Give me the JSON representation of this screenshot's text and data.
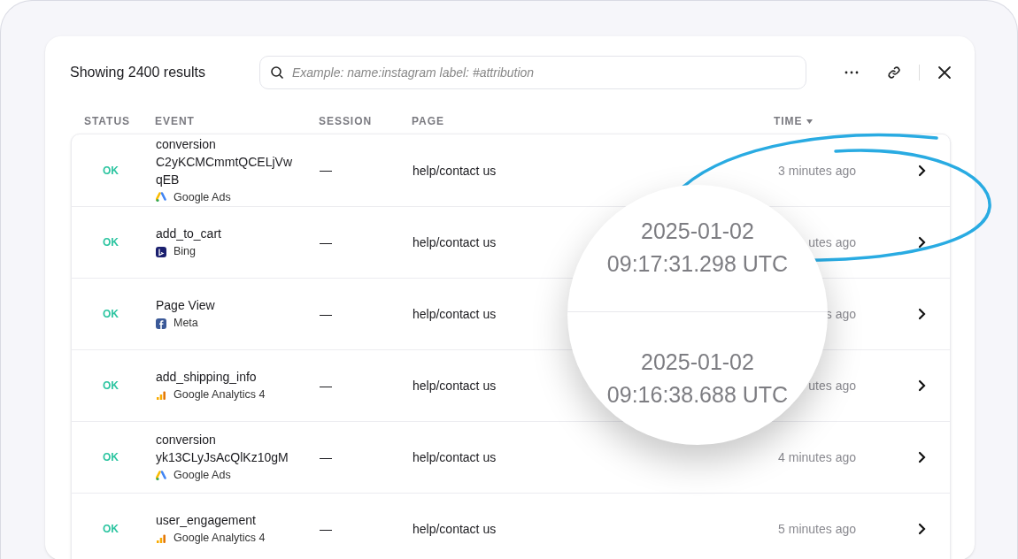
{
  "header": {
    "title": "Showing 2400 results",
    "search": {
      "placeholder": "Example: name:instagram label: #attribution"
    }
  },
  "columns": [
    {
      "label": "STATUS",
      "sorted": false
    },
    {
      "label": "EVENT",
      "sorted": false
    },
    {
      "label": "SESSION",
      "sorted": false
    },
    {
      "label": "PAGE",
      "sorted": false
    },
    {
      "label": "TIME",
      "sorted": true
    }
  ],
  "rows": [
    {
      "status": "OK",
      "event": [
        "conversion",
        "C2yKCMCmmtQCELjVw",
        "qEB"
      ],
      "source": {
        "kind": "google-ads",
        "name": "Google Ads"
      },
      "session": "—",
      "page": "help/contact us",
      "time": "3 minutes ago"
    },
    {
      "status": "OK",
      "event": [
        "add_to_cart"
      ],
      "source": {
        "kind": "bing",
        "name": "Bing"
      },
      "session": "—",
      "page": "help/contact us",
      "time": "utes ago"
    },
    {
      "status": "OK",
      "event": [
        "Page View"
      ],
      "source": {
        "kind": "meta",
        "name": "Meta"
      },
      "session": "—",
      "page": "help/contact us",
      "time": "s ago"
    },
    {
      "status": "OK",
      "event": [
        "add_shipping_info"
      ],
      "source": {
        "kind": "ga4",
        "name": "Google Analytics 4"
      },
      "session": "—",
      "page": "help/contact us",
      "time": "utes ago"
    },
    {
      "status": "OK",
      "event": [
        "conversion",
        "yk13CLyJsAcQlKz10gM"
      ],
      "source": {
        "kind": "google-ads",
        "name": "Google Ads"
      },
      "session": "—",
      "page": "help/contact us",
      "time": "4 minutes ago"
    },
    {
      "status": "OK",
      "event": [
        "user_engagement"
      ],
      "source": {
        "kind": "ga4",
        "name": "Google Analytics 4"
      },
      "session": "—",
      "page": "help/contact us",
      "time": "5 minutes ago"
    }
  ],
  "magnifier": [
    {
      "date": "2025-01-02",
      "time": "09:17:31.298 UTC"
    },
    {
      "date": "2025-01-02",
      "time": "09:16:38.688 UTC"
    }
  ]
}
